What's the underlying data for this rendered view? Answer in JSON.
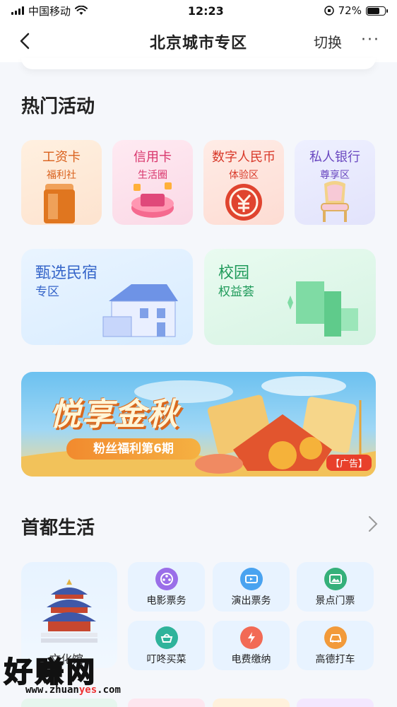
{
  "status_bar": {
    "carrier": "中国移动",
    "time": "12:23",
    "battery": "72%",
    "battery_level": 0.72
  },
  "nav": {
    "title": "北京城市专区",
    "switch_label": "切换",
    "more_label": "···"
  },
  "hot": {
    "title": "热门活动",
    "tiles": [
      {
        "line1": "工资卡",
        "line2": "福利社",
        "icon": "salary-card-icon",
        "accent": "#e0761f"
      },
      {
        "line1": "信用卡",
        "line2": "生活圈",
        "icon": "credit-card-icon",
        "accent": "#e0487a"
      },
      {
        "line1": "数字人民币",
        "line2": "体验区",
        "icon": "digital-rmb-icon",
        "accent": "#e0442f"
      },
      {
        "line1": "私人银行",
        "line2": "尊享区",
        "icon": "private-bank-chair-icon",
        "accent": "#7a56c8"
      }
    ],
    "big_tiles": [
      {
        "line1": "甄选民宿",
        "line2": "专区",
        "icon": "house-icon",
        "accent": "#3e6fd8"
      },
      {
        "line1": "校园",
        "line2": "权益荟",
        "icon": "scroll-icon",
        "accent": "#2fa665"
      }
    ]
  },
  "banner": {
    "title": "悦享金秋",
    "subtitle": "粉丝福利第6期",
    "ad_tag": "【广告】"
  },
  "life": {
    "title": "首都生活",
    "big_label": "文化馆",
    "items": [
      {
        "label": "电影票务",
        "icon": "film-icon",
        "color": "#9a6ee8"
      },
      {
        "label": "演出票务",
        "icon": "ticket-icon",
        "color": "#4aa3f0"
      },
      {
        "label": "景点门票",
        "icon": "scenery-icon",
        "color": "#35b07a"
      },
      {
        "label": "叮咚买菜",
        "icon": "vegetable-icon",
        "color": "#2fb39b"
      },
      {
        "label": "电费缴纳",
        "icon": "lightning-icon",
        "color": "#f26a55"
      },
      {
        "label": "高德打车",
        "icon": "taxi-icon",
        "color": "#f29a3a"
      }
    ]
  },
  "watermark": {
    "big": "好赚网",
    "url_pre": "www.zhuan",
    "url_mid": "yes",
    "url_post": ".com"
  }
}
